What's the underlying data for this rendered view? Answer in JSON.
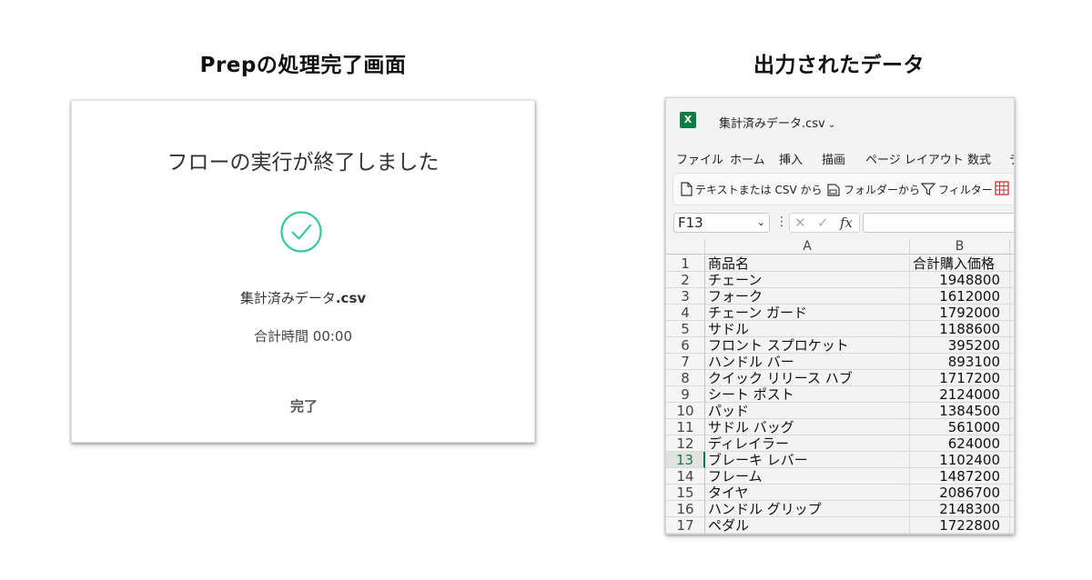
{
  "captions": {
    "left": "Prepの処理完了画面",
    "right": "出力されたデータ"
  },
  "prep_dialog": {
    "title": "フローの実行が終了しました",
    "file_base": "集計済みデータ",
    "file_ext": ".csv",
    "time_label": "合計時間",
    "time_value": "00:00",
    "done_button": "完了",
    "accent_color": "#3dc7a0"
  },
  "excel": {
    "file_name": "集計済みデータ.csv",
    "menu": [
      "ファイル",
      "ホーム",
      "挿入",
      "描画",
      "ページ レイアウト",
      "数式",
      "デ"
    ],
    "ribbon": {
      "text_csv": "テキストまたは CSV から",
      "folder": "フォルダーから",
      "filter": "フィルター"
    },
    "name_box": "F13",
    "formula_icons": {
      "cancel": "✕",
      "confirm": "✓",
      "fx": "fx"
    },
    "columns": [
      "A",
      "B"
    ],
    "selected_row": 13,
    "header_row": {
      "num": "1",
      "a": "商品名",
      "b": "合計購入価格"
    },
    "rows": [
      {
        "num": "2",
        "a": "チェーン",
        "b": "1948800"
      },
      {
        "num": "3",
        "a": "フォーク",
        "b": "1612000"
      },
      {
        "num": "4",
        "a": "チェーン ガード",
        "b": "1792000"
      },
      {
        "num": "5",
        "a": "サドル",
        "b": "1188600"
      },
      {
        "num": "6",
        "a": "フロント スプロケット",
        "b": "395200"
      },
      {
        "num": "7",
        "a": "ハンドル バー",
        "b": "893100"
      },
      {
        "num": "8",
        "a": "クイック リリース ハブ",
        "b": "1717200"
      },
      {
        "num": "9",
        "a": "シート ポスト",
        "b": "2124000"
      },
      {
        "num": "10",
        "a": "パッド",
        "b": "1384500"
      },
      {
        "num": "11",
        "a": "サドル バッグ",
        "b": "561000"
      },
      {
        "num": "12",
        "a": "ディレイラー",
        "b": "624000"
      },
      {
        "num": "13",
        "a": "ブレーキ レバー",
        "b": "1102400"
      },
      {
        "num": "14",
        "a": "フレーム",
        "b": "1487200"
      },
      {
        "num": "15",
        "a": "タイヤ",
        "b": "2086700"
      },
      {
        "num": "16",
        "a": "ハンドル グリップ",
        "b": "2148300"
      },
      {
        "num": "17",
        "a": "ペダル",
        "b": "1722800"
      }
    ]
  }
}
